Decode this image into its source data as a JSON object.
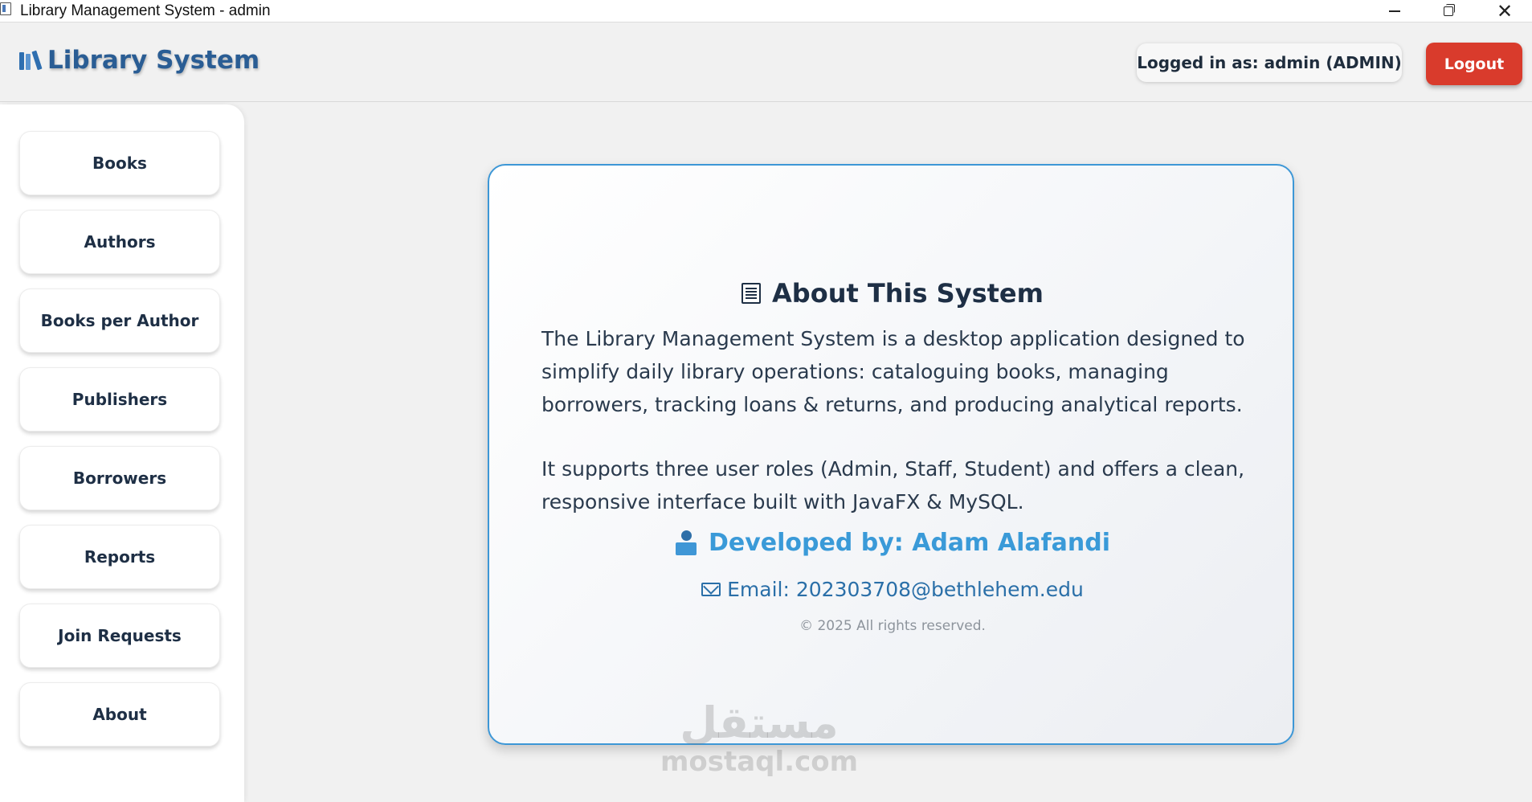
{
  "window": {
    "title": "Library Management System - admin",
    "minimize_icon": "minimize-icon",
    "maximize_icon": "restore-icon",
    "close_icon": "close-icon",
    "close_glyph": "✕"
  },
  "header": {
    "brand_icon": "books-icon",
    "brand_title": "Library System",
    "user_label": "Logged in as: admin (ADMIN)",
    "logout_label": "Logout",
    "colors": {
      "brand": "#2a5d94",
      "logout": "#d93b2c"
    }
  },
  "sidebar": {
    "items": [
      {
        "label": "Books"
      },
      {
        "label": "Authors"
      },
      {
        "label": "Books per Author"
      },
      {
        "label": "Publishers"
      },
      {
        "label": "Borrowers"
      },
      {
        "label": "Reports"
      },
      {
        "label": "Join Requests"
      },
      {
        "label": "About"
      }
    ]
  },
  "about": {
    "heading_icon": "document-icon",
    "heading": "About This System",
    "paragraph1": "The Library Management System is a desktop application designed to simplify daily library operations: cataloguing books, managing borrowers, tracking loans & returns, and producing analytical reports.",
    "paragraph2": "It supports three user roles (Admin, Staff, Student) and offers a clean, responsive interface built with JavaFX & MySQL.",
    "developer_icon": "developer-icon",
    "developer": "Developed by: Adam Alafandi",
    "email_icon": "email-icon",
    "email": "Email: 202303708@bethlehem.edu",
    "copyright": "© 2025 All rights reserved.",
    "colors": {
      "border": "#3d97d6",
      "developer": "#3a9ad8",
      "email": "#2a6fa8"
    }
  },
  "watermark": {
    "arabic": "مستقل",
    "latin": "mostaql.com"
  }
}
